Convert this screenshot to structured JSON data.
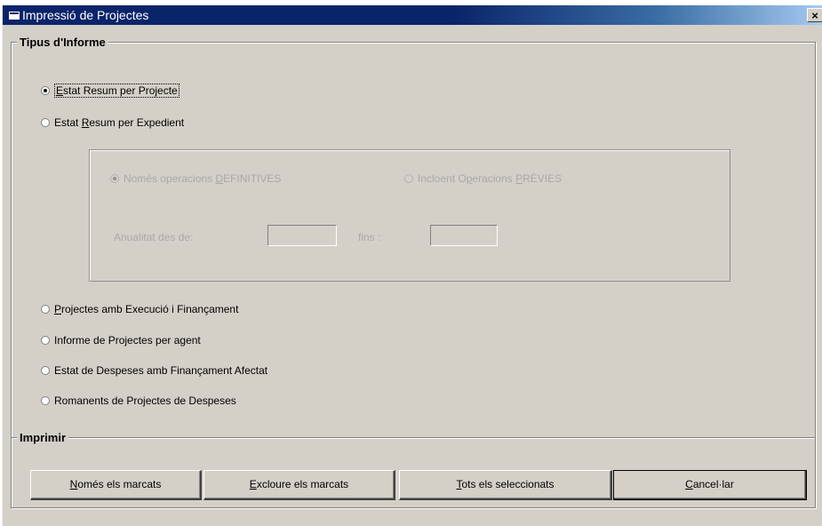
{
  "window": {
    "title": "Impressió de Projectes",
    "close_label": "×"
  },
  "report_type": {
    "legend": "Tipus d'Informe",
    "options": [
      {
        "pre": "",
        "mn": "E",
        "post": "stat Resum per Projecte",
        "checked": true
      },
      {
        "pre": "Estat ",
        "mn": "R",
        "post": "esum per Expedient",
        "checked": false
      },
      {
        "pre": "",
        "mn": "P",
        "post": "rojectes amb Execució i Finançament",
        "checked": false
      },
      {
        "pre": "Informe de Projectes per agent",
        "mn": "",
        "post": "",
        "checked": false
      },
      {
        "pre": "Estat de Despeses amb Finançament Afectat",
        "mn": "",
        "post": "",
        "checked": false
      },
      {
        "pre": "Romanents de Projectes de Despeses",
        "mn": "",
        "post": "",
        "checked": false
      }
    ]
  },
  "subpanel": {
    "option_definitive": {
      "pre": "Només operacions ",
      "mn": "D",
      "post": "EFINITIVES",
      "checked": true
    },
    "option_previous": {
      "pre": "Incloent O",
      "mn": "p",
      "post": "eracions ",
      "mn2": "P",
      "post2": "RÈVIES",
      "checked": false
    },
    "annuality_label": "Anualitat des de:",
    "annuality_from_value": "",
    "until_label": "fins :",
    "annuality_to_value": ""
  },
  "print": {
    "legend": "Imprimir",
    "buttons": [
      {
        "pre": "",
        "mn": "N",
        "post": "omés els marcats"
      },
      {
        "pre": "",
        "mn": "E",
        "post": "xcloure els marcats"
      },
      {
        "pre": "",
        "mn": "T",
        "post": "ots els seleccionats"
      },
      {
        "pre": "",
        "mn": "C",
        "post": "ancel·lar"
      }
    ]
  }
}
